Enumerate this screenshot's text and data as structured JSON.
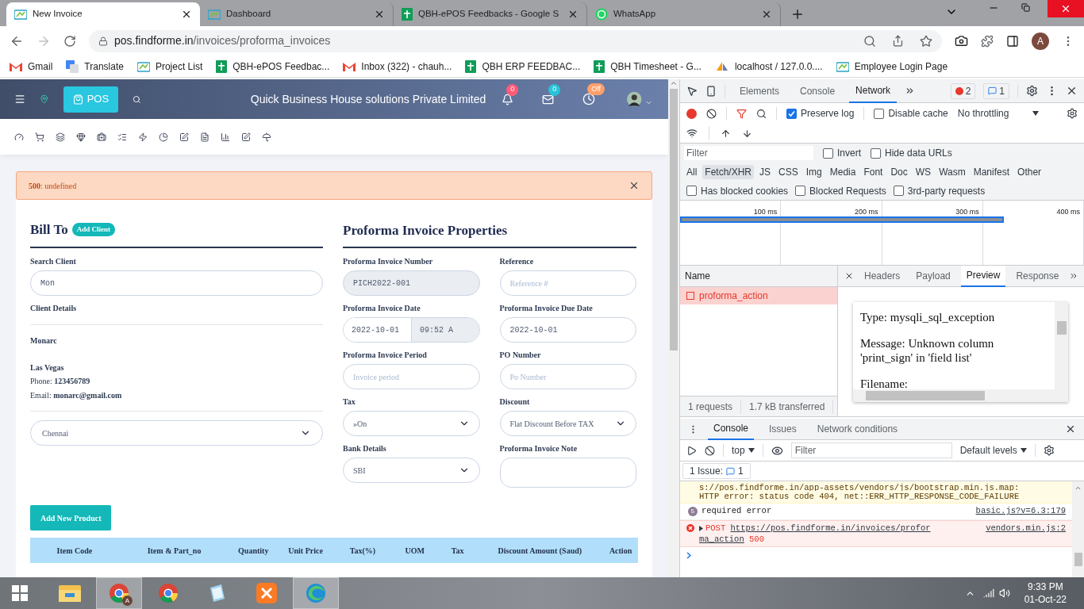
{
  "browser": {
    "tabs": [
      {
        "title": "New Invoice",
        "kind": "site",
        "selected": true
      },
      {
        "title": "Dashboard",
        "kind": "site",
        "selected": false
      },
      {
        "title": "QBH-ePOS Feedbacks - Google S",
        "kind": "sheets",
        "selected": false
      },
      {
        "title": "WhatsApp",
        "kind": "whatsapp",
        "selected": false
      }
    ],
    "host": "pos.findforme.in",
    "path": "/invoices/proforma_invoices",
    "profile": "A",
    "bookmarks": [
      {
        "title": "Gmail",
        "kind": "gmail"
      },
      {
        "title": "Translate",
        "kind": "translate"
      },
      {
        "title": "Project List",
        "kind": "site"
      },
      {
        "title": "QBH-ePOS Feedbac...",
        "kind": "sheets"
      },
      {
        "title": "Inbox (322) - chauh...",
        "kind": "gmail"
      },
      {
        "title": "QBH ERP FEEDBAC...",
        "kind": "sheets"
      },
      {
        "title": "QBH Timesheet - G...",
        "kind": "sheets"
      },
      {
        "title": "localhost / 127.0.0....",
        "kind": "pma"
      },
      {
        "title": "Employee Login Page",
        "kind": "site"
      }
    ]
  },
  "app": {
    "pos_button": "POS",
    "company": "Quick Business House solutions Private Limited",
    "notifications": "0",
    "messages": "0",
    "clock": "Off"
  },
  "alert": {
    "text": "**500**: undefined"
  },
  "bill_to": {
    "title": "Bill To",
    "add_client": "Add Client",
    "search_label": "Search Client",
    "search_value": "Mon",
    "details_label": "Client Details",
    "client_name": "Monarc",
    "city": "Las Vegas",
    "phone": "Phone: **123456789**",
    "email": "Email: **monarc@gmail.com**",
    "location": "Chennai"
  },
  "properties": {
    "title": "Proforma Invoice Properties",
    "fields": [
      {
        "label": "Proforma Invoice Number",
        "kind": "readonly",
        "value": "PICH2022-001"
      },
      {
        "label": "Reference",
        "kind": "text",
        "placeholder": "Reference #"
      },
      {
        "label": "Proforma Invoice Date",
        "kind": "datetime",
        "value": "2022-10-01",
        "time": "09:52 A"
      },
      {
        "label": "Proforma Invoice Due Date",
        "kind": "text",
        "value": "2022-10-01"
      },
      {
        "label": "Proforma Invoice Period",
        "kind": "text",
        "placeholder": "Invoice period"
      },
      {
        "label": "PO Number",
        "kind": "text",
        "placeholder": "Po Number"
      },
      {
        "label": "Tax",
        "kind": "select",
        "value": "»On"
      },
      {
        "label": "Discount",
        "kind": "select",
        "value": "Flat Discount Before TAX"
      },
      {
        "label": "Bank Details",
        "kind": "select",
        "value": "SBI"
      },
      {
        "label": "Proforma Invoice Note",
        "kind": "textarea"
      }
    ]
  },
  "add_product": "Add New Product",
  "table": {
    "columns": [
      "Item Code",
      "Item & Part_no",
      "Quantity",
      "Unit Price",
      "Tax(%)",
      "UOM",
      "Tax",
      "Discount Amount (Saud)",
      "Action"
    ]
  },
  "devtools": {
    "tabs": [
      {
        "label": "Elements",
        "selected": false
      },
      {
        "label": "Console",
        "selected": false
      },
      {
        "label": "Network",
        "selected": true
      }
    ],
    "errors": "2",
    "issues": "1",
    "preserve_log": {
      "label": "Preserve log",
      "checked": true
    },
    "disable_cache": {
      "label": "Disable cache",
      "checked": false
    },
    "throttling": "No throttling",
    "filter_placeholder": "Filter",
    "filter_checks": [
      {
        "label": "Invert",
        "checked": false
      },
      {
        "label": "Hide data URLs",
        "checked": false
      }
    ],
    "types": [
      {
        "label": "All",
        "selected": false
      },
      {
        "label": "Fetch/XHR",
        "selected": true
      },
      {
        "label": "JS",
        "selected": false
      },
      {
        "label": "CSS",
        "selected": false
      },
      {
        "label": "Img",
        "selected": false
      },
      {
        "label": "Media",
        "selected": false
      },
      {
        "label": "Font",
        "selected": false
      },
      {
        "label": "Doc",
        "selected": false
      },
      {
        "label": "WS",
        "selected": false
      },
      {
        "label": "Wasm",
        "selected": false
      },
      {
        "label": "Manifest",
        "selected": false
      },
      {
        "label": "Other",
        "selected": false
      }
    ],
    "blocked_checks": [
      {
        "label": "Has blocked cookies",
        "checked": false
      },
      {
        "label": "Blocked Requests",
        "checked": false
      },
      {
        "label": "3rd-party requests",
        "checked": false
      }
    ],
    "ticks": [
      "100 ms",
      "200 ms",
      "300 ms",
      "400 ms"
    ],
    "name_header": "Name",
    "requests": [
      {
        "name": "proforma_action",
        "failed": true
      }
    ],
    "summary": [
      "1 requests",
      "1.7 kB transferred"
    ],
    "detail_tabs": [
      {
        "label": "Headers",
        "selected": false
      },
      {
        "label": "Payload",
        "selected": false
      },
      {
        "label": "Preview",
        "selected": true
      },
      {
        "label": "Response",
        "selected": false
      }
    ],
    "preview": [
      "Type: mysqli_sql_exception",
      "Message: Unknown column 'print_sign' in 'field list'",
      "Filename:"
    ],
    "drawer_tabs": [
      {
        "label": "Console",
        "selected": true
      },
      {
        "label": "Issues",
        "selected": false
      },
      {
        "label": "Network conditions",
        "selected": false
      }
    ],
    "context": "top",
    "console_filter_placeholder": "Filter",
    "levels": "Default levels",
    "issue_label": "1 Issue:",
    "issue_count": "1",
    "messages": [
      {
        "kind": "warning",
        "lines": [
          "s://pos.findforme.in/app-assets/vendors/js/bootstrap.min.js.map:",
          "HTTP error: status code 404, net::ERR_HTTP_RESPONSE_CODE_FAILURE"
        ]
      },
      {
        "kind": "info",
        "count": "5",
        "text": "required error",
        "source": "basic.js?v=6.3:179"
      },
      {
        "kind": "error",
        "method": "POST",
        "url": "https://pos.findforme.in/invoices/profor",
        "url_rest": "ma_action",
        "status": "500",
        "source": "vendors.min.js:2"
      }
    ]
  },
  "taskbar": {
    "apps": [
      {
        "kind": "explorer",
        "selected": false
      },
      {
        "kind": "chrome",
        "selected": true,
        "badge": "A"
      },
      {
        "kind": "chrome",
        "selected": false
      },
      {
        "kind": "notepad",
        "selected": false
      },
      {
        "kind": "xampp",
        "selected": false
      },
      {
        "kind": "edge",
        "selected": true
      }
    ],
    "time": "9:33 PM",
    "date": "01-Oct-22"
  }
}
